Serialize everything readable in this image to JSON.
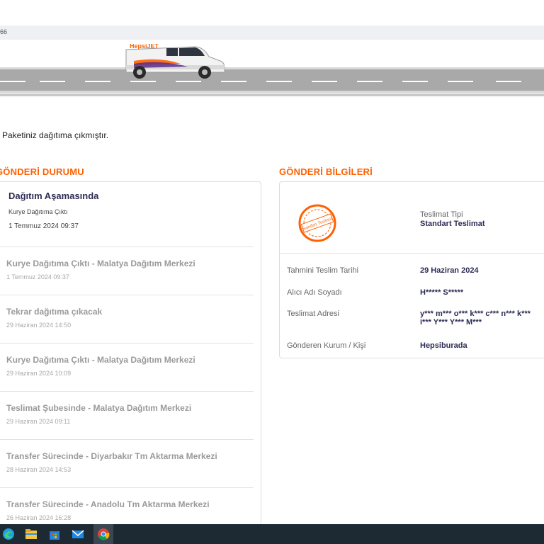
{
  "browser": {
    "address_fragment": "66"
  },
  "header": {
    "status_message": "Paketiniz dağıtıma çıkmıştır."
  },
  "shipment_status": {
    "title": "GÖNDERİ DURUMU",
    "current": {
      "stage": "Dağıtım Aşamasında",
      "detail": "Kurye Dağıtıma Çıktı",
      "datetime": "1 Temmuz 2024 09:37"
    },
    "history": [
      {
        "title": "Kurye Dağıtıma Çıktı - Malatya Dağıtım Merkezi",
        "datetime": "1 Temmuz 2024 09:37"
      },
      {
        "title": "Tekrar dağıtıma çıkacak",
        "datetime": "29 Haziran 2024 14:50"
      },
      {
        "title": "Kurye Dağıtıma Çıktı - Malatya Dağıtım Merkezi",
        "datetime": "29 Haziran 2024 10:09"
      },
      {
        "title": "Teslimat Şubesinde - Malatya Dağıtım Merkezi",
        "datetime": "29 Haziran 2024 09:11"
      },
      {
        "title": "Transfer Sürecinde - Diyarbakır Tm Aktarma Merkezi",
        "datetime": "28 Haziran 2024 14:53"
      },
      {
        "title": "Transfer Sürecinde - Anadolu Tm Aktarma Merkezi",
        "datetime": "26 Haziran 2024 16:28"
      }
    ]
  },
  "shipment_info": {
    "title": "GÖNDERİ BİLGİLERİ",
    "stamp_text": "Standart Teslimat",
    "delivery_type_label": "Teslimat Tipi",
    "delivery_type_value": "Standart Teslimat",
    "rows": [
      {
        "label": "Tahmini Teslim Tarihi",
        "value": "29 Haziran 2024"
      },
      {
        "label": "Alıcı Adı Soyadı",
        "value": "H***** S*****"
      },
      {
        "label": "Teslimat Adresi",
        "value": "y*** m*** o*** k*** c*** n*** k*** i*** Y*** Y*** M***"
      },
      {
        "label": "Gönderen Kurum / Kişi",
        "value": "Hepsiburada"
      }
    ]
  },
  "van": {
    "brand_text": "HepsiJET"
  },
  "colors": {
    "accent": "#ff6000",
    "heading_text": "#2c2c55",
    "taskbar": "#1e2a33"
  },
  "taskbar": {
    "icons": [
      "edge-icon",
      "file-explorer-icon",
      "store-icon",
      "mail-icon",
      "chrome-icon"
    ]
  }
}
